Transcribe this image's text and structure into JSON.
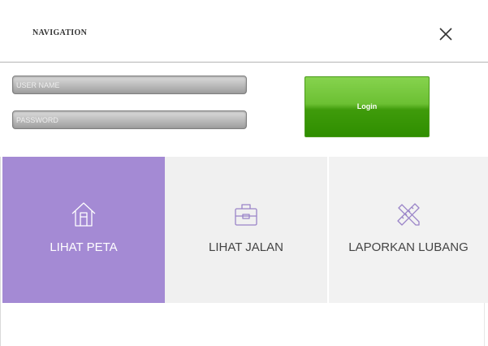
{
  "header": {
    "title": "NAVIGATION",
    "close_icon": "close-icon"
  },
  "login": {
    "username_placeholder": "USER NAME",
    "password_placeholder": "PASSWORD",
    "button_label": "Login"
  },
  "menu": {
    "items": [
      {
        "label": "LIHAT PETA",
        "icon": "home-icon",
        "active": true
      },
      {
        "label": "LIHAT JALAN",
        "icon": "toolbox-icon",
        "active": false
      },
      {
        "label": "LAPORKAN LUBANG",
        "icon": "tools-icon",
        "active": false
      }
    ]
  },
  "colors": {
    "active_tile": "#a48ad4",
    "inactive_tile": "#f0f0f0",
    "login_green": "#4fb11a",
    "icon_active": "#ffffff",
    "icon_inactive": "#9a84c8"
  }
}
